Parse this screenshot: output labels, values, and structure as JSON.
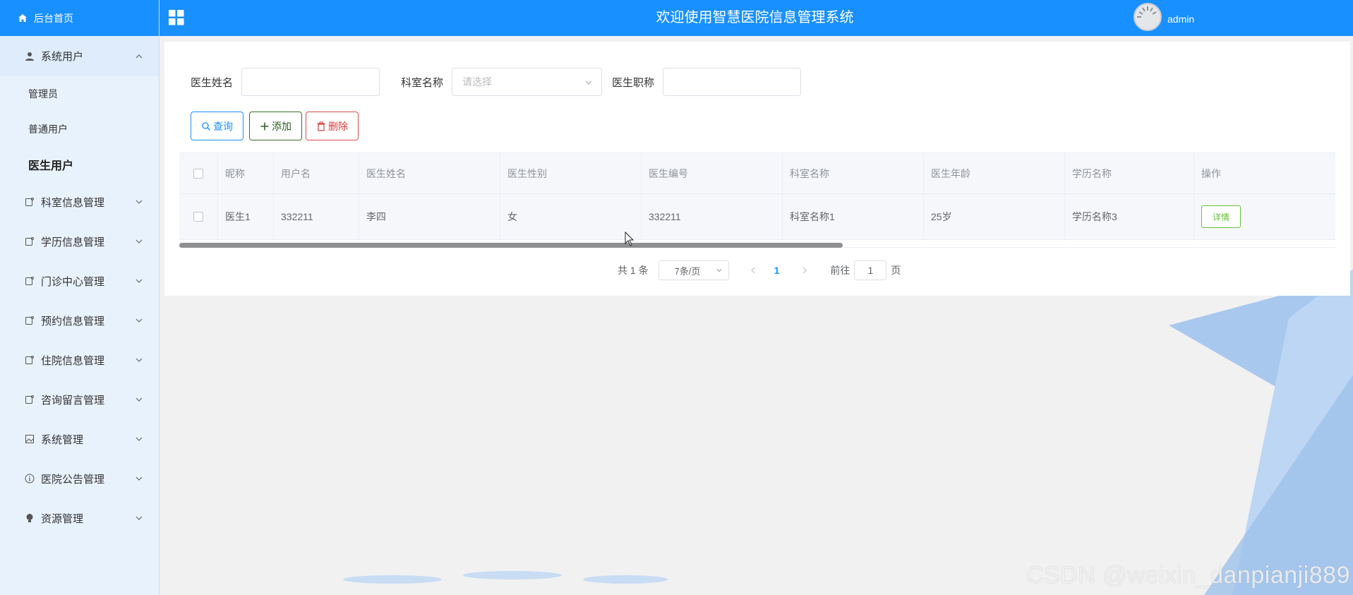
{
  "header": {
    "title": "欢迎使用智慧医院信息管理系统",
    "username": "admin",
    "brand_color": "#1890ff"
  },
  "sidebar": {
    "home_label": "后台首页",
    "group_open": {
      "label": "系统用户",
      "items": [
        {
          "label": "管理员"
        },
        {
          "label": "普通用户"
        },
        {
          "label": "医生用户",
          "active": true
        }
      ]
    },
    "items": [
      {
        "label": "科室信息管理",
        "icon": "tag-icon"
      },
      {
        "label": "学历信息管理",
        "icon": "tag-icon"
      },
      {
        "label": "门诊中心管理",
        "icon": "tag-icon"
      },
      {
        "label": "预约信息管理",
        "icon": "tag-icon"
      },
      {
        "label": "住院信息管理",
        "icon": "tag-icon"
      },
      {
        "label": "咨询留言管理",
        "icon": "tag-icon"
      },
      {
        "label": "系统管理",
        "icon": "picture-icon"
      },
      {
        "label": "医院公告管理",
        "icon": "info-icon"
      },
      {
        "label": "资源管理",
        "icon": "bulb-icon"
      }
    ]
  },
  "search": {
    "doctor_name_label": "医生姓名",
    "doctor_name_value": "",
    "dept_label": "科室名称",
    "dept_placeholder": "请选择",
    "title_label": "医生职称",
    "title_value": ""
  },
  "actions": {
    "query": "查询",
    "add": "添加",
    "delete": "删除"
  },
  "table": {
    "columns": [
      "昵称",
      "用户名",
      "医生姓名",
      "医生性别",
      "医生编号",
      "科室名称",
      "医生年龄",
      "学历名称",
      "操作"
    ],
    "rows": [
      {
        "nickname": "医生1",
        "username": "332211",
        "name": "李四",
        "gender": "女",
        "code": "332211",
        "dept": "科室名称1",
        "age": "25岁",
        "education": "学历名称3",
        "op": "详情"
      }
    ]
  },
  "pagination": {
    "total": "共 1 条",
    "page_size": "7条/页",
    "current_page": "1",
    "goto_label": "前往",
    "goto_value": "1",
    "page_suffix": "页"
  },
  "watermark": "CSDN @weixin_danpianji889"
}
